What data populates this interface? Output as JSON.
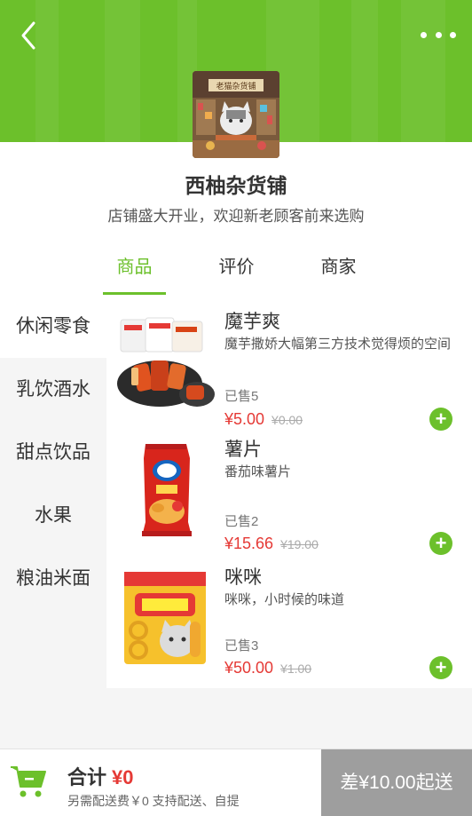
{
  "nav": {
    "back_icon": "chevron-left-icon",
    "more_icon": "more-dots-icon"
  },
  "shop": {
    "name": "西柚杂货铺",
    "description": "店铺盛大开业，欢迎新老顾客前来选购",
    "logo_sign": "老猫杂货铺"
  },
  "tabs": [
    {
      "label": "商品",
      "active": true
    },
    {
      "label": "评价",
      "active": false
    },
    {
      "label": "商家",
      "active": false
    }
  ],
  "categories": [
    {
      "label": "休闲零食",
      "active": true
    },
    {
      "label": "乳饮酒水",
      "active": false
    },
    {
      "label": "甜点饮品",
      "active": false
    },
    {
      "label": "水果",
      "active": false
    },
    {
      "label": "粮油米面",
      "active": false
    }
  ],
  "products": [
    {
      "name": "魔芋爽",
      "desc": "魔芋撒娇大幅第三方技术觉得烦的空间",
      "sold": "已售5",
      "price": "¥5.00",
      "old_price": "¥0.00",
      "image": "konjac-snack-image"
    },
    {
      "name": "薯片",
      "desc": "番茄味薯片",
      "sold": "已售2",
      "price": "¥15.66",
      "old_price": "¥19.00",
      "image": "potato-chips-bag-image"
    },
    {
      "name": "咪咪",
      "desc": "咪咪，小时候的味道",
      "sold": "已售3",
      "price": "¥50.00",
      "old_price": "¥1.00",
      "image": "mimi-snack-bag-image"
    }
  ],
  "cart": {
    "total_label": "合计",
    "total_amount": "¥0",
    "fee_text": "另需配送费￥0 支持配送、自提",
    "min_button": "差¥10.00起送"
  },
  "colors": {
    "brand": "#6cc02b",
    "price": "#e53935",
    "disabled": "#9e9e9e"
  }
}
